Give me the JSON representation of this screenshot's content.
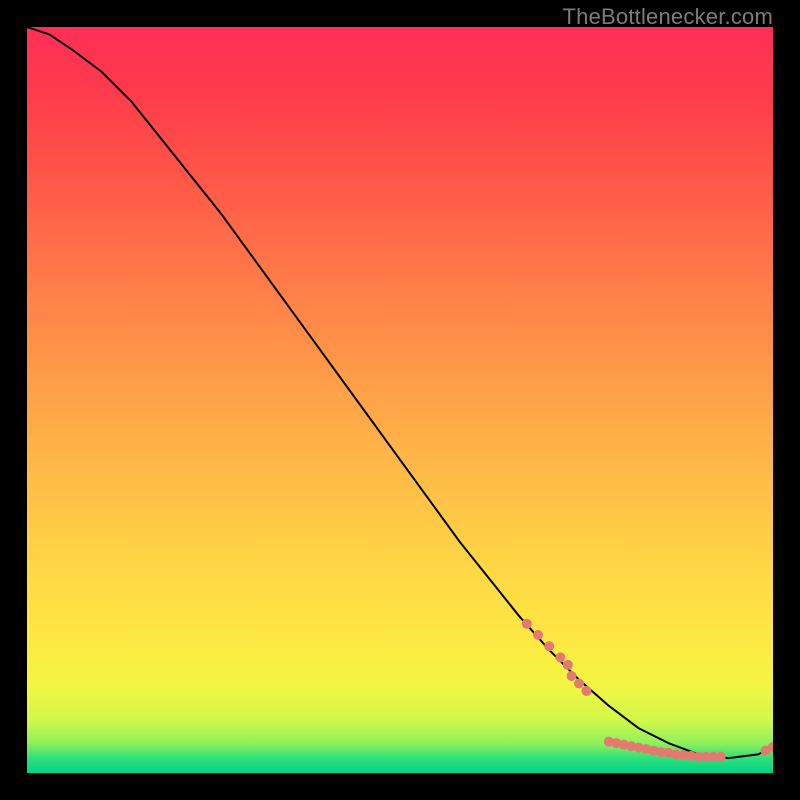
{
  "watermark": "TheBottlenecker.com",
  "chart_data": {
    "type": "line",
    "title": "",
    "xlabel": "",
    "ylabel": "",
    "xlim": [
      0,
      100
    ],
    "ylim": [
      0,
      100
    ],
    "grid": false,
    "series": [
      {
        "name": "curve",
        "color": "#000000",
        "x": [
          0,
          3,
          6,
          10,
          14,
          18,
          22,
          26,
          30,
          34,
          38,
          42,
          46,
          50,
          54,
          58,
          62,
          66,
          70,
          74,
          78,
          82,
          86,
          90,
          94,
          98,
          100
        ],
        "y": [
          100,
          99,
          97,
          94,
          90,
          85,
          80,
          75,
          69.5,
          64,
          58.5,
          53,
          47.5,
          42,
          36.5,
          31,
          26,
          21,
          16.5,
          12.5,
          9,
          6,
          4,
          2.5,
          2,
          2.5,
          3.5
        ]
      }
    ],
    "markers": [
      {
        "name": "segment-a",
        "color": "#e47a6f",
        "radius": 5,
        "x": [
          67,
          68.5,
          70,
          71.5,
          72.5,
          73,
          74,
          75
        ],
        "y": [
          20,
          18.5,
          17,
          15.5,
          14.5,
          13,
          12,
          11
        ]
      },
      {
        "name": "segment-b",
        "color": "#e47a6f",
        "radius": 5,
        "x": [
          78,
          79,
          80,
          81,
          82,
          83,
          84,
          85,
          86,
          87,
          88,
          89,
          90,
          91,
          92,
          93
        ],
        "y": [
          4.2,
          4.0,
          3.8,
          3.6,
          3.4,
          3.2,
          3.0,
          2.8,
          2.7,
          2.5,
          2.4,
          2.3,
          2.2,
          2.2,
          2.2,
          2.2
        ]
      },
      {
        "name": "segment-c",
        "color": "#e47a6f",
        "radius": 5,
        "x": [
          99,
          100
        ],
        "y": [
          3.0,
          3.5
        ]
      }
    ]
  }
}
